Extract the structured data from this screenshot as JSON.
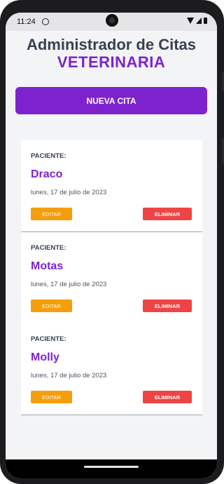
{
  "status_bar": {
    "time": "11:24"
  },
  "header": {
    "title": "Administrador de Citas",
    "subtitle": "VETERINARIA"
  },
  "new_button": {
    "label": "NUEVA CITA"
  },
  "appointments": [
    {
      "label": "PACIENTE:",
      "name": "Draco",
      "date": "lunes, 17 de julio de 2023",
      "edit_label": "EDITAR",
      "delete_label": "ELIMINAR"
    },
    {
      "label": "PACIENTE:",
      "name": "Motas",
      "date": "lunes, 17 de julio de 2023",
      "edit_label": "EDITAR",
      "delete_label": "ELIMINAR"
    },
    {
      "label": "PACIENTE:",
      "name": "Molly",
      "date": "lunes, 17 de julio de 2023",
      "edit_label": "EDITAR",
      "delete_label": "ELIMINAR"
    }
  ],
  "colors": {
    "accent": "#7e22ce",
    "edit": "#f59e0b",
    "delete": "#ef4444"
  },
  "icons": [
    "app-notification-icon",
    "wifi-icon",
    "signal-icon",
    "battery-icon",
    "camera-icon"
  ]
}
